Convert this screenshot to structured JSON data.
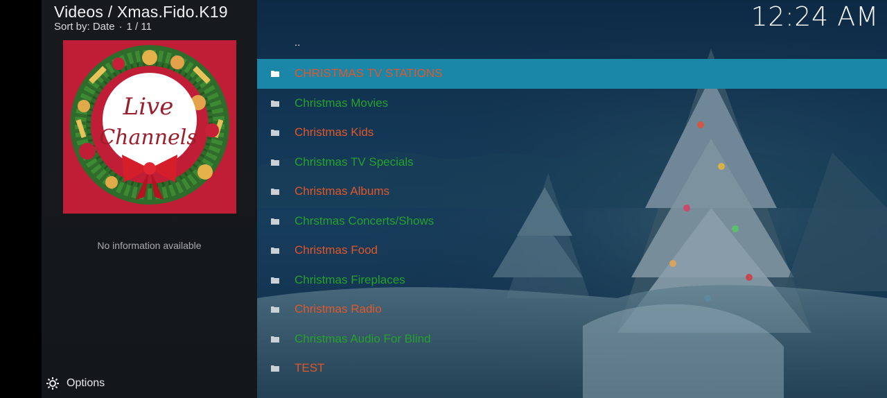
{
  "header": {
    "breadcrumb": "Videos / Xmas.Fido.K19",
    "sort_label": "Sort by: Date",
    "separator": "·",
    "position": "1 / 11",
    "clock": "12:24 AM"
  },
  "thumbnail": {
    "line1": "Live",
    "line2": "Channels"
  },
  "info": {
    "empty_text": "No information available"
  },
  "footer": {
    "options_label": "Options",
    "options_icon": "gear-icon"
  },
  "list": {
    "parent_label": "..",
    "items": [
      {
        "label": "CHRISTMAS TV STATIONS",
        "color": "#e0572a",
        "selected": true
      },
      {
        "label": "Christmas Movies",
        "color": "#26a12c"
      },
      {
        "label": "Christmas Kids",
        "color": "#e0572a"
      },
      {
        "label": "Christmas TV Specials",
        "color": "#26a12c"
      },
      {
        "label": "Christmas Albums",
        "color": "#e0572a"
      },
      {
        "label": "Chrstmas Concerts/Shows",
        "color": "#26a12c"
      },
      {
        "label": "Christmas Food",
        "color": "#e0572a"
      },
      {
        "label": "Christmas Fireplaces",
        "color": "#26a12c"
      },
      {
        "label": "Christmas Radio",
        "color": "#e0572a"
      },
      {
        "label": "Christmas Audio For Blind",
        "color": "#26a12c"
      },
      {
        "label": "TEST",
        "color": "#e0572a"
      }
    ]
  },
  "colors": {
    "selection": "#1b87a8",
    "panel": "#171a1d",
    "orange": "#e0572a",
    "green": "#26a12c"
  }
}
